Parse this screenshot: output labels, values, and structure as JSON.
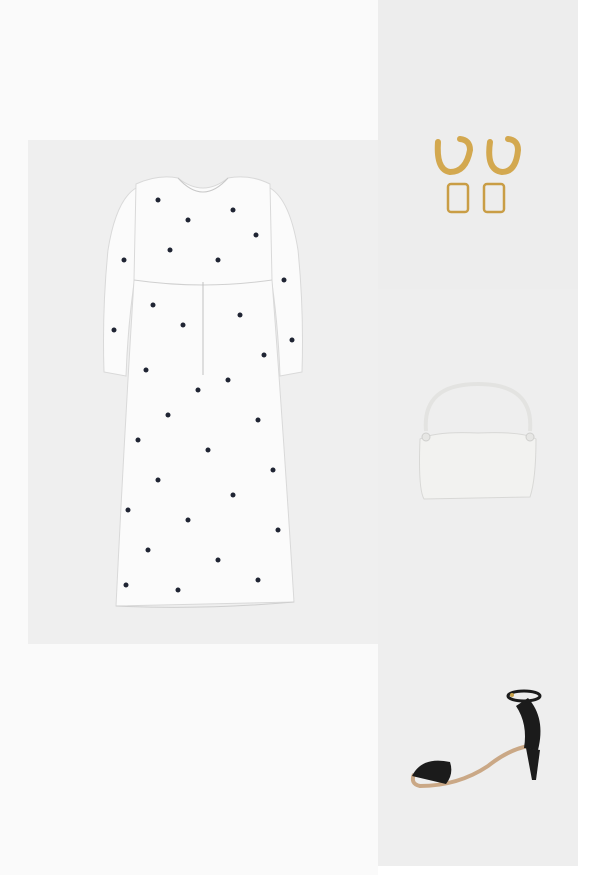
{
  "outfit": {
    "items": [
      {
        "id": "dress",
        "icon": "dress-icon"
      },
      {
        "id": "earrings",
        "icon": "earrings-icon"
      },
      {
        "id": "handbag",
        "icon": "handbag-icon"
      },
      {
        "id": "sandal",
        "icon": "sandal-icon"
      }
    ]
  },
  "colors": {
    "page": "#ffffff",
    "tile": "#efefef",
    "dress": "#fbfbfb",
    "dots": "#1f2433",
    "gold": "#d3a84f",
    "bag": "#f2f2f0",
    "shoe": "#1b1b1b"
  }
}
